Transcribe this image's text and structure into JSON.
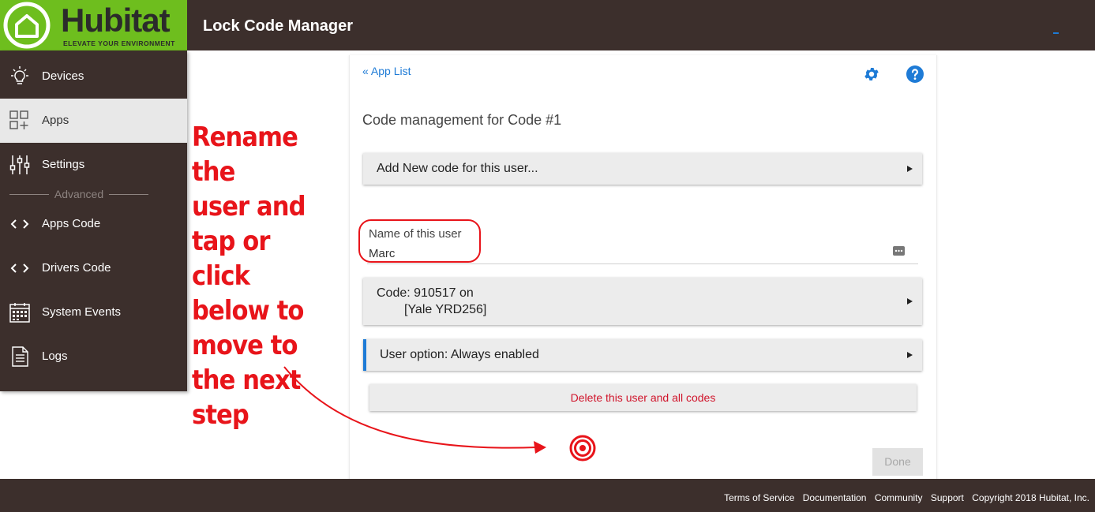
{
  "header": {
    "logo_text": "Hubitat",
    "logo_tagline": "ELEVATE YOUR ENVIRONMENT",
    "app_title": "Lock Code Manager"
  },
  "sidebar": {
    "items": [
      {
        "label": "Devices",
        "icon": "lightbulb-icon"
      },
      {
        "label": "Apps",
        "icon": "apps-grid-icon",
        "active": true
      },
      {
        "label": "Settings",
        "icon": "sliders-icon"
      },
      {
        "label": "Apps Code",
        "icon": "code-icon"
      },
      {
        "label": "Drivers Code",
        "icon": "code-icon"
      },
      {
        "label": "System Events",
        "icon": "calendar-icon"
      },
      {
        "label": "Logs",
        "icon": "document-icon"
      }
    ],
    "advanced_label": "Advanced"
  },
  "main": {
    "back_link": "« App List",
    "section_title": "Code management for Code #1",
    "add_code_label": "Add New code for this user...",
    "name_field": {
      "label": "Name of this user",
      "value": "Marc"
    },
    "code_row": {
      "line1": "Code: 910517 on",
      "line2": "[Yale YRD256]"
    },
    "user_option": "User option: Always enabled",
    "delete_label": "Delete this user and all codes",
    "done_label": "Done"
  },
  "annotation": {
    "lines": [
      "Rename the",
      "user and",
      "tap or click",
      "below to",
      "move to",
      "the next",
      "step"
    ]
  },
  "footer": {
    "links": [
      "Terms of Service",
      "Documentation",
      "Community",
      "Support"
    ],
    "copyright": "Copyright 2018 Hubitat, Inc."
  },
  "colors": {
    "header_bg": "#3c2f2c",
    "logo_green": "#6ebe1e",
    "accent_blue": "#1e7bd6",
    "annotation_red": "#e8141a",
    "delete_red": "#d0142b"
  }
}
